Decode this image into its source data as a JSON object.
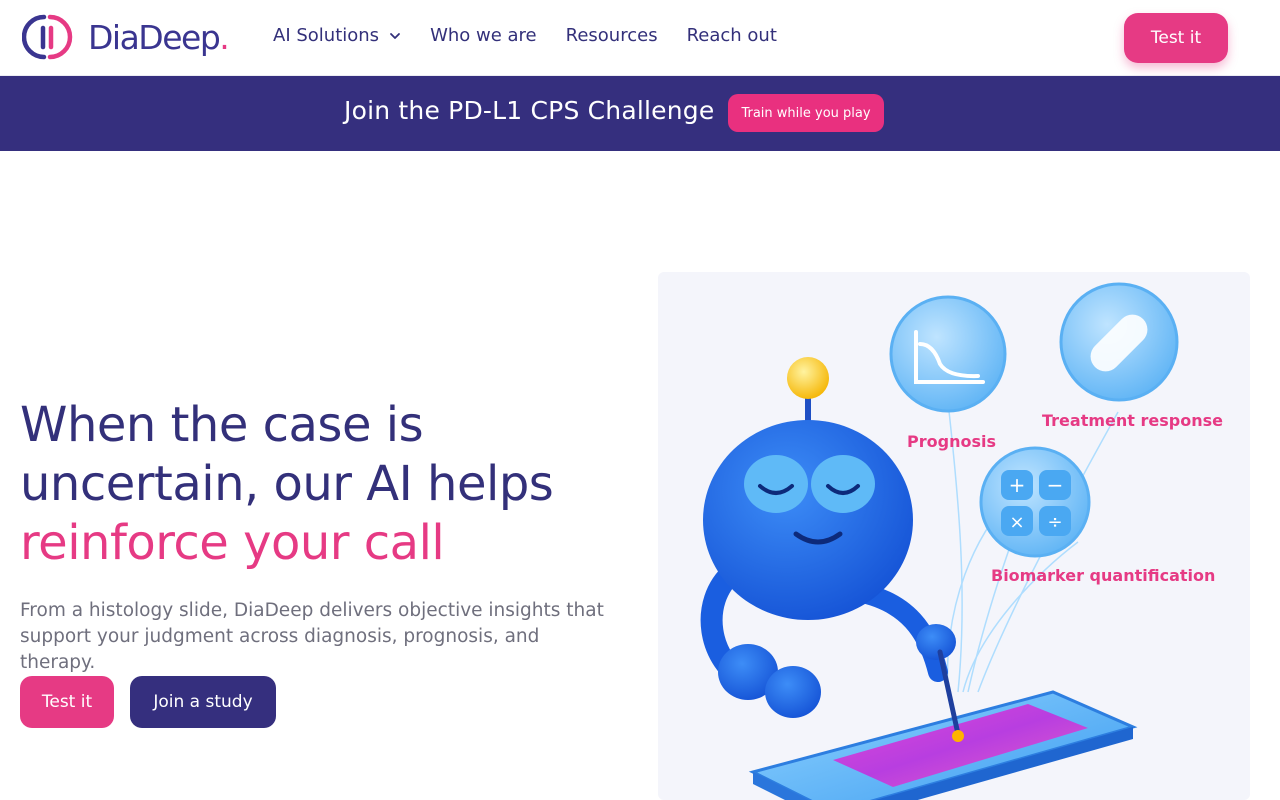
{
  "header": {
    "logo_text": "DiaDeep",
    "logo_dot": ".",
    "nav": [
      {
        "label": "AI Solutions",
        "has_dropdown": true
      },
      {
        "label": "Who we are"
      },
      {
        "label": "Resources"
      },
      {
        "label": "Reach out"
      }
    ],
    "cta_label": "Test it"
  },
  "banner": {
    "text": "Join the PD-L1 CPS Challenge",
    "button_label": "Train while you play"
  },
  "hero": {
    "title_line1": "When the case is",
    "title_line2": "uncertain, our AI helps",
    "title_accent": "reinforce your call",
    "subtitle": "From a histology slide, DiaDeep delivers objective insights that support your judgment across diagnosis, prognosis, and therapy.",
    "primary_button": "Test it",
    "secondary_button": "Join a study"
  },
  "illustration": {
    "features": [
      {
        "label": "Prognosis",
        "icon": "survival-curve-icon"
      },
      {
        "label": "Treatment response",
        "icon": "pill-icon"
      },
      {
        "label": "Biomarker quantification",
        "icon": "calculator-icon"
      }
    ]
  },
  "colors": {
    "brand_navy": "#352f7e",
    "brand_pink": "#e63a84",
    "robot_blue": "#1f6ef0"
  }
}
